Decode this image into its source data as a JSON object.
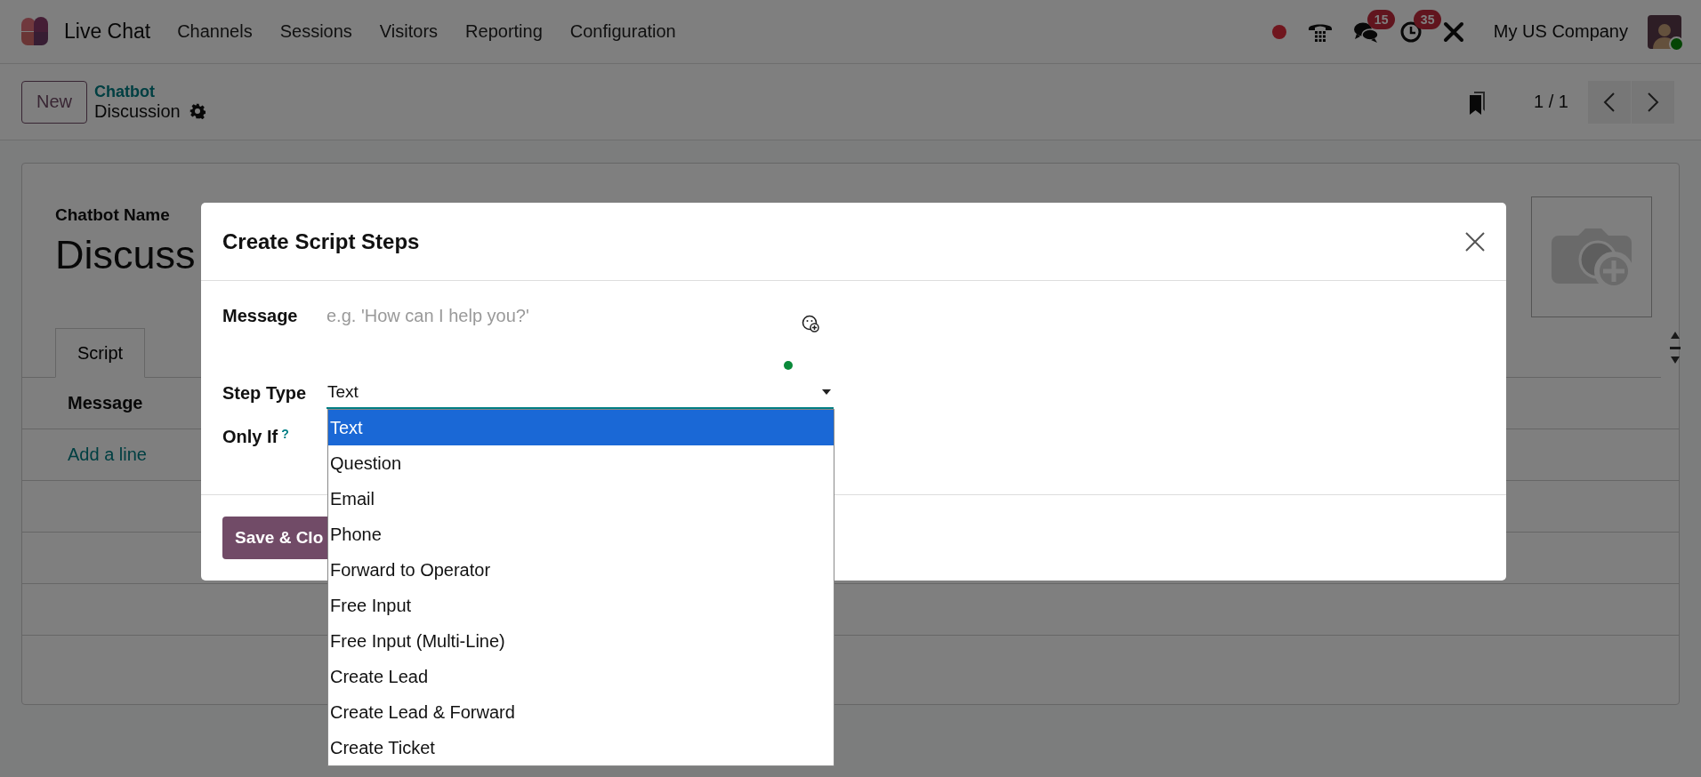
{
  "navbar": {
    "app_name": "Live Chat",
    "menu": [
      "Channels",
      "Sessions",
      "Visitors",
      "Reporting",
      "Configuration"
    ],
    "systray": [
      {
        "kind": "recording"
      },
      {
        "kind": "phone"
      },
      {
        "kind": "chat",
        "badge": "15"
      },
      {
        "kind": "activity",
        "badge": "35"
      },
      {
        "kind": "tools"
      }
    ],
    "company": "My US Company",
    "user_online": true
  },
  "control_panel": {
    "new_button": "New",
    "breadcrumb_parent": "Chatbot",
    "breadcrumb_current": "Discussion",
    "pager": "1 / 1"
  },
  "form": {
    "name_label": "Chatbot Name",
    "name_value": "Discuss",
    "tabs": [
      {
        "label": "Script",
        "selected": true
      }
    ],
    "table": {
      "columns": [
        "Message"
      ],
      "add_line": "Add a line"
    }
  },
  "dialog": {
    "title": "Create Script Steps",
    "fields": [
      {
        "kind": "textarea",
        "label": "Message",
        "placeholder": "e.g. 'How can I help you?'"
      },
      {
        "kind": "select",
        "label": "Step Type",
        "value": "Text"
      },
      {
        "kind": "domain",
        "label": "Only If",
        "help": "?"
      }
    ],
    "save_button": "Save & Clo"
  },
  "dropdown": {
    "options": [
      {
        "label": "Text",
        "selected": true
      },
      {
        "label": "Question",
        "selected": false
      },
      {
        "label": "Email",
        "selected": false
      },
      {
        "label": "Phone",
        "selected": false
      },
      {
        "label": "Forward to Operator",
        "selected": false
      },
      {
        "label": "Free Input",
        "selected": false
      },
      {
        "label": "Free Input (Multi-Line)",
        "selected": false
      },
      {
        "label": "Create Lead",
        "selected": false
      },
      {
        "label": "Create Lead & Forward",
        "selected": false
      },
      {
        "label": "Create Ticket",
        "selected": false
      }
    ]
  }
}
